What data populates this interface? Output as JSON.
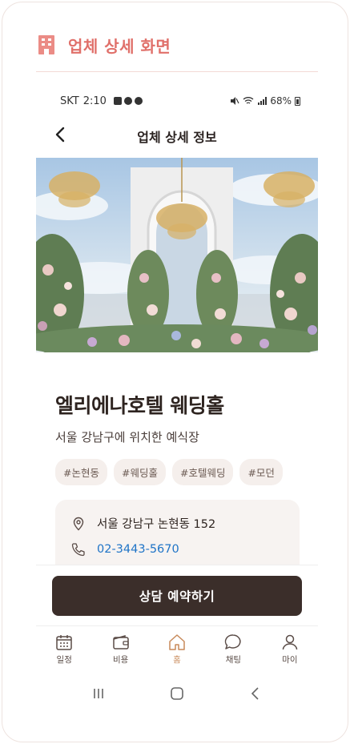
{
  "app_header": {
    "title": "업체 상세 화면",
    "icon": "building-icon"
  },
  "status_bar": {
    "carrier": "SKT",
    "time": "2:10",
    "battery": "68%"
  },
  "nav": {
    "title": "업체 상세 정보",
    "back_icon": "chevron-left-icon"
  },
  "hero": {
    "alt": "wedding hall chandelier arch"
  },
  "venue": {
    "name": "엘리에나호텔 웨딩홀",
    "description": "서울 강남구에 위치한 예식장",
    "tags": [
      "#논현동",
      "#웨딩홀",
      "#호텔웨딩",
      "#모던"
    ],
    "address": "서울 강남구 논현동 152",
    "phone": "02-3443-5670"
  },
  "cta": {
    "label": "상담 예약하기"
  },
  "tabs": [
    {
      "label": "일정",
      "icon": "calendar-icon",
      "active": false
    },
    {
      "label": "비용",
      "icon": "wallet-icon",
      "active": false
    },
    {
      "label": "홈",
      "icon": "home-icon",
      "active": true
    },
    {
      "label": "채팅",
      "icon": "chat-icon",
      "active": false
    },
    {
      "label": "마이",
      "icon": "person-icon",
      "active": false
    }
  ],
  "colors": {
    "accent": "#e0706a",
    "cta": "#3b2e2a",
    "link": "#1f74c7",
    "active_tab": "#c88a5a"
  }
}
